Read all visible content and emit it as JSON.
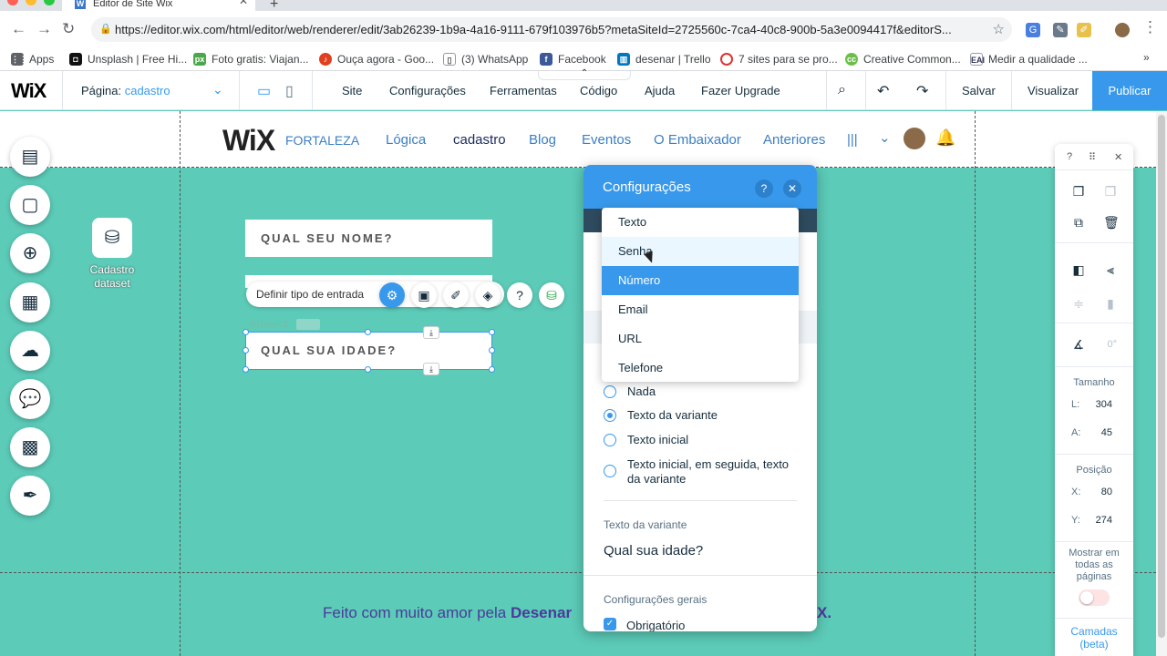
{
  "browser": {
    "tab_title": "Editor de Site Wix",
    "url": "https://editor.wix.com/html/editor/web/renderer/edit/3ab26239-1b9a-4a16-9111-679f103976b5?metaSiteId=2725560c-7ca4-40c8-900b-5a3e0094417f&editorS...",
    "bookmarks": [
      "Apps",
      "Unsplash | Free Hi...",
      "Foto gratis: Viajan...",
      "Ouça agora - Goo...",
      "(3) WhatsApp",
      "Facebook",
      "desenar | Trello",
      "7 sites para se pro...",
      "Creative Common...",
      "Medir a qualidade ..."
    ]
  },
  "editor": {
    "logo": "WiX",
    "page_label": "Página:",
    "page_value": "cadastro",
    "menu": [
      "Site",
      "Configurações",
      "Ferramentas",
      "Código",
      "Ajuda",
      "Fazer Upgrade"
    ],
    "save": "Salvar",
    "preview": "Visualizar",
    "publish": "Publicar"
  },
  "site": {
    "logo": "WiX",
    "logo_sub": "FORTALEZA",
    "menu": [
      "Lógica",
      "cadastro",
      "Blog",
      "Eventos",
      "O Embaixador",
      "Anteriores",
      "|||"
    ],
    "dataset_label": "Cadastro dataset",
    "input_name": "QUAL SEU NOME?",
    "input_age": "QUAL SUA IDADE?",
    "element_id": "#input3",
    "floating_action": "Definir tipo de entrada",
    "footer_prefix": "Feito com muito amor pela ",
    "footer_bold": "Desenar",
    "footer_end": "X."
  },
  "settings_panel": {
    "title": "Configurações",
    "input_types": [
      "Texto",
      "Senha",
      "Número",
      "Email",
      "URL",
      "Telefone"
    ],
    "hovered": "Senha",
    "selected": "Número",
    "radio_options": [
      "Nada",
      "Texto da variante",
      "Texto inicial",
      "Texto inicial, em seguida, texto da variante"
    ],
    "radio_selected": "Texto da variante",
    "variant_label": "Texto da variante",
    "variant_value": "Qual sua idade?",
    "general_label": "Configurações gerais",
    "required_label": "Obrigatório"
  },
  "right_panel": {
    "help": "?",
    "rotation": "0°",
    "size_label": "Tamanho",
    "width_label": "L:",
    "width_value": "304",
    "height_label": "A:",
    "height_value": "45",
    "position_label": "Posição",
    "x_label": "X:",
    "x_value": "80",
    "y_label": "Y:",
    "y_value": "274",
    "show_all_pages": "Mostrar em todas as páginas",
    "layers": "Camadas (beta)"
  },
  "colors": {
    "accent": "#3899ec",
    "canvas": "#5ccbb8",
    "site_link": "#3a7fc5"
  }
}
